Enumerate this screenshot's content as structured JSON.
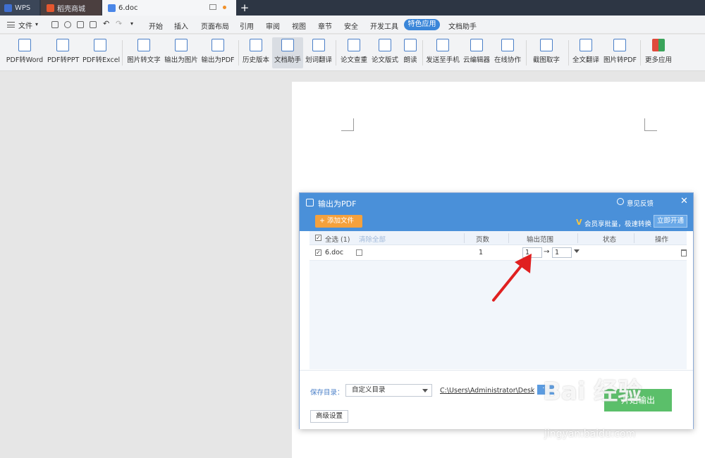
{
  "tabs": [
    {
      "label": "WPS"
    },
    {
      "label": "稻壳商城"
    },
    {
      "label": "6.doc"
    }
  ],
  "menubar": {
    "file_label": "文件",
    "items": [
      "开始",
      "插入",
      "页面布局",
      "引用",
      "审阅",
      "视图",
      "章节",
      "安全",
      "开发工具",
      "特色应用",
      "文档助手"
    ],
    "active_item": "特色应用"
  },
  "ribbon": {
    "buttons": [
      "PDF转Word",
      "PDF转PPT",
      "PDF转Excel",
      "图片转文字",
      "输出为图片",
      "输出为PDF",
      "历史版本",
      "文档助手",
      "划词翻译",
      "论文查重",
      "论文版式",
      "朗读",
      "发送至手机",
      "云编辑器",
      "在线协作",
      "截图取字",
      "全文翻译",
      "图片转PDF",
      "更多应用"
    ],
    "active_button": "文档助手"
  },
  "dialog": {
    "title": "输出为PDF",
    "feedback_label": "意见反馈",
    "add_file_label": "添加文件",
    "vip_text": "会员享批量，极速转换",
    "open_now_label": "立即开通",
    "select_all_label": "全选 (1)",
    "clear_all_label": "清除全部",
    "columns": {
      "pages": "页数",
      "range": "输出范围",
      "status": "状态",
      "action": "操作"
    },
    "rows": [
      {
        "name": "6.doc",
        "pages": "1",
        "range_from": "1",
        "range_to": "1"
      }
    ],
    "save_dir_label": "保存目录：",
    "save_dir_option": "自定义目录",
    "save_path": "C:\\Users\\Administrator\\Desktop",
    "more_label": "···",
    "start_label": "开始输出",
    "advanced_label": "高级设置"
  },
  "watermark": {
    "main": "Bai 经验",
    "sub": "jingyan.baidu.com"
  },
  "colors": {
    "accent": "#4a90d9",
    "start_button": "#5bbf6a",
    "add_file": "#f5a13c",
    "arrow": "#e02020"
  }
}
